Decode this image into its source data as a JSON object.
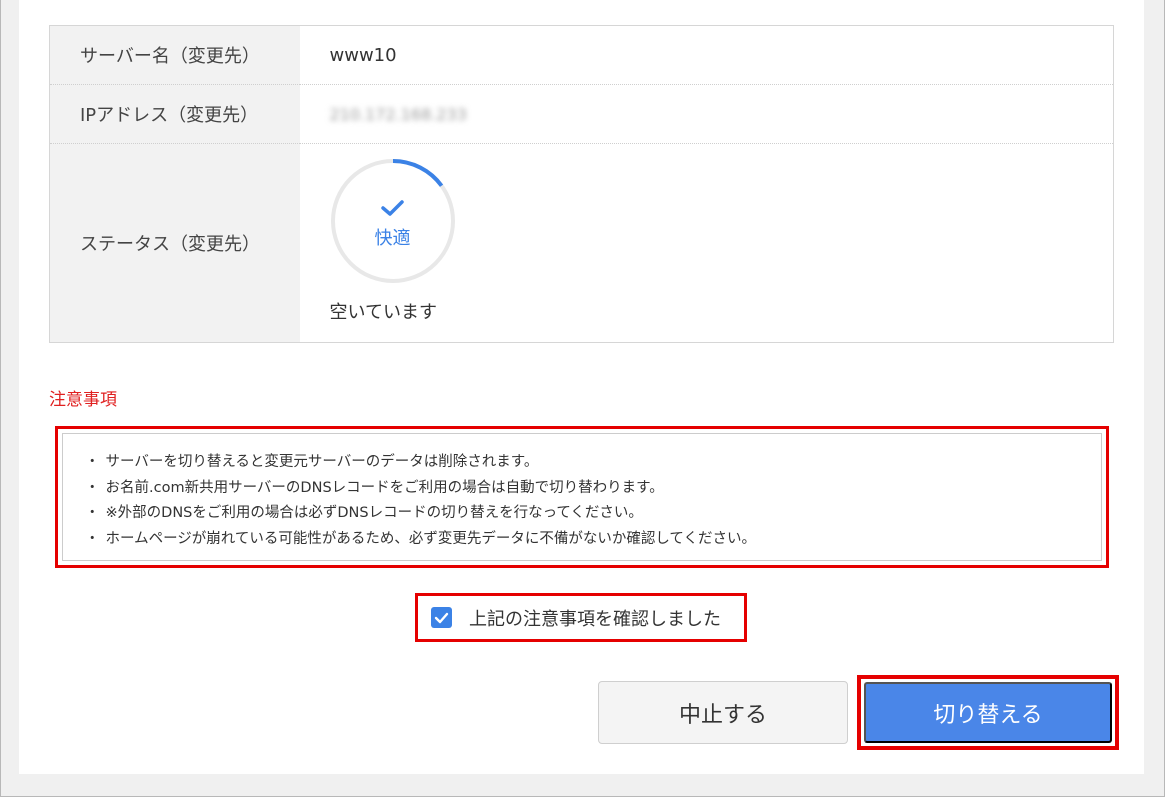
{
  "server_info": {
    "rows": [
      {
        "label": "サーバー名（変更先）",
        "value": "www10"
      },
      {
        "label": "IPアドレス（変更先）",
        "value": "210.172.168.233"
      },
      {
        "label": "ステータス（変更先）"
      }
    ],
    "status": {
      "gauge_label": "快適",
      "description": "空いています",
      "level": 0.15,
      "accent_color": "#3b82e6"
    }
  },
  "notice": {
    "title": "注意事項",
    "items": [
      "サーバーを切り替えると変更元サーバーのデータは削除されます。",
      "お名前.com新共用サーバーのDNSレコードをご利用の場合は自動で切り替わります。",
      "※外部のDNSをご利用の場合は必ずDNSレコードの切り替えを行なってください。",
      "ホームページが崩れている可能性があるため、必ず変更先データに不備がないか確認してください。"
    ]
  },
  "confirm": {
    "checked": true,
    "label": "上記の注意事項を確認しました"
  },
  "buttons": {
    "cancel": "中止する",
    "switch": "切り替える"
  },
  "colors": {
    "highlight": "#e50000",
    "primary": "#4a86e8",
    "notice_title": "#e02020"
  }
}
